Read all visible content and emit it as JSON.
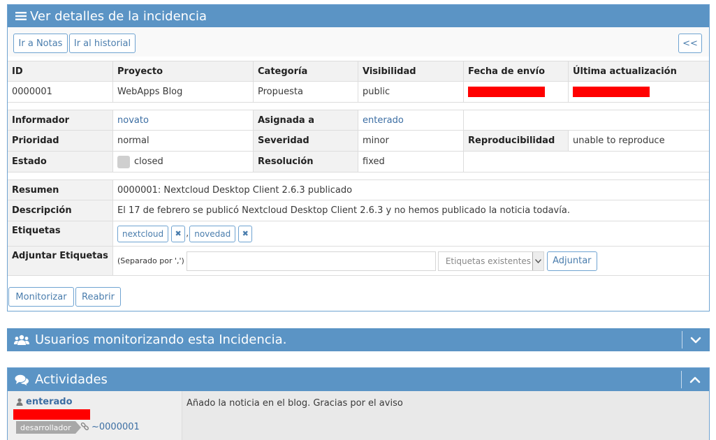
{
  "details": {
    "title": "Ver detalles de la incidencia",
    "buttons": {
      "notes": "Ir a Notas",
      "history": "Ir al historial",
      "nav": "<<"
    },
    "headers": [
      "ID",
      "Proyecto",
      "Categoría",
      "Visibilidad",
      "Fecha de envío",
      "Última actualización"
    ],
    "values": {
      "id": "0000001",
      "project": "WebApps Blog",
      "category": "Propuesta",
      "visibility": "public"
    },
    "fields": {
      "reporter_label": "Informador",
      "reporter": "novato",
      "assigned_label": "Asignada a",
      "assigned": "enterado",
      "priority_label": "Prioridad",
      "priority": "normal",
      "severity_label": "Severidad",
      "severity": "minor",
      "reproducibility_label": "Reproducibilidad",
      "reproducibility": "unable to reproduce",
      "status_label": "Estado",
      "status": "closed",
      "resolution_label": "Resolución",
      "resolution": "fixed"
    },
    "summary_label": "Resumen",
    "summary": "0000001: Nextcloud Desktop Client 2.6.3 publicado",
    "description_label": "Descripción",
    "description": "El 17 de febrero se publicó Nextcloud Desktop Client 2.6.3 y no hemos publicado la noticia todavía.",
    "tags_label": "Etiquetas",
    "tags": [
      "nextcloud",
      "novedad"
    ],
    "tag_separator": ",",
    "attach_label": "Adjuntar Etiquetas",
    "attach_hint": "(Separado por ',')",
    "attach_input": "",
    "existing_tags": "Etiquetas existentes",
    "attach_button": "Adjuntar",
    "monitor_button": "Monitorizar",
    "reopen_button": "Reabrir"
  },
  "monitor": {
    "title": "Usuarios monitorizando esta Incidencia."
  },
  "activity": {
    "title": "Actividades",
    "user": "enterado",
    "role": "desarrollador",
    "note_link": "~0000001",
    "note_text": "Añado la noticia en el blog. Gracias por el aviso"
  },
  "colors": {
    "header": "#5b94c5",
    "link": "#3c6ea3",
    "redaction": "#ff0000"
  }
}
